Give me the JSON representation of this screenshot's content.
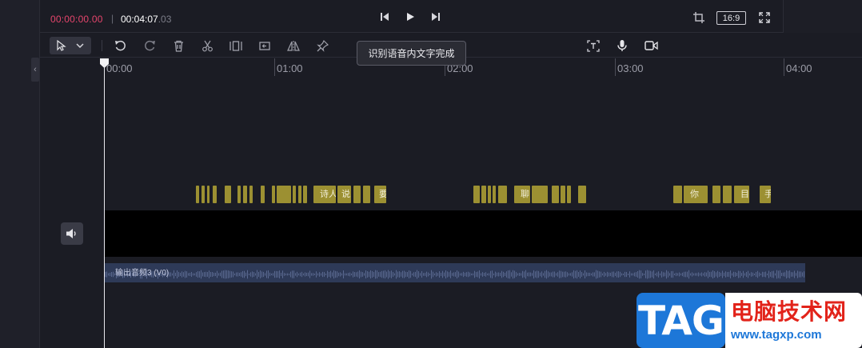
{
  "player": {
    "current_time": "00:00:00.00",
    "separator": "|",
    "total_time_main": "00:04:07",
    "total_time_frac": ".03",
    "aspect_ratio": "16:9"
  },
  "toolbar": {
    "tools": [
      "select-pointer",
      "undo",
      "redo",
      "delete",
      "split",
      "freeze",
      "reverse",
      "mirror",
      "pin",
      "text-recognition",
      "microphone",
      "camera"
    ],
    "tooltip": "识别语音内文字完成"
  },
  "timeline": {
    "ruler_labels": [
      "00:00",
      "01:00",
      "02:00",
      "03:00",
      "04:00"
    ],
    "playhead_time": "00:00"
  },
  "subtitle_track": {
    "clip_fill": "#9c9032",
    "visible_texts": [
      "诗人",
      "说",
      "要",
      "聊",
      "你",
      "目",
      "手"
    ]
  },
  "audio_track": {
    "label": "输出音频3 (V0)",
    "clip_fill": "#2e3a58"
  },
  "watermark": {
    "badge": "TAG",
    "text": "电脑技术网",
    "url": "www.tagxp.com"
  },
  "colors": {
    "accent_time": "#e5456c",
    "background": "#1b1c24"
  }
}
